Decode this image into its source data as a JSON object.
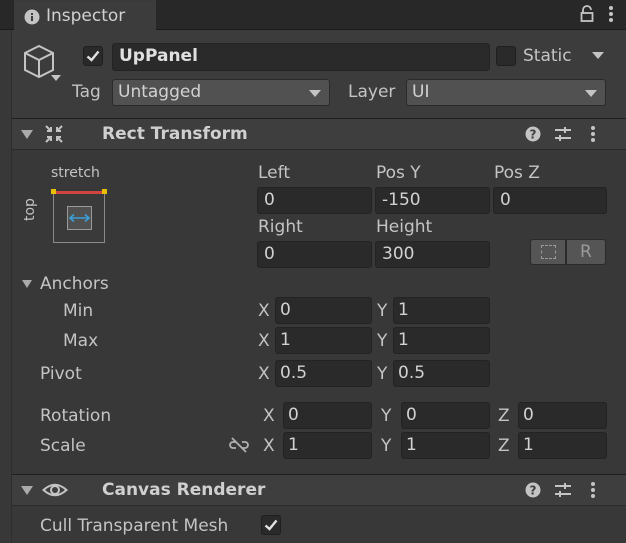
{
  "tab": {
    "title": "Inspector",
    "icon": "info-icon"
  },
  "object": {
    "active": true,
    "name": "UpPanel",
    "static_label": "Static",
    "static": false
  },
  "tag": {
    "label": "Tag",
    "value": "Untagged"
  },
  "layer": {
    "label": "Layer",
    "value": "UI"
  },
  "rect_transform": {
    "title": "Rect Transform",
    "anchor_preset": {
      "top_label": "stretch",
      "side_label": "top"
    },
    "labels": {
      "left": "Left",
      "pos_y": "Pos Y",
      "pos_z": "Pos Z",
      "right": "Right",
      "height": "Height"
    },
    "values": {
      "left": "0",
      "pos_y": "-150",
      "pos_z": "0",
      "right": "0",
      "height": "300"
    },
    "raw_button_label": "R",
    "anchors": {
      "label": "Anchors",
      "min": {
        "label": "Min",
        "x": "0",
        "y": "1"
      },
      "max": {
        "label": "Max",
        "x": "1",
        "y": "1"
      }
    },
    "pivot": {
      "label": "Pivot",
      "x": "0.5",
      "y": "0.5"
    },
    "rotation": {
      "label": "Rotation",
      "x": "0",
      "y": "0",
      "z": "0"
    },
    "scale": {
      "label": "Scale",
      "x": "1",
      "y": "1",
      "z": "1"
    },
    "axis": {
      "x": "X",
      "y": "Y",
      "z": "Z"
    }
  },
  "canvas_renderer": {
    "title": "Canvas Renderer",
    "cull_label": "Cull Transparent Mesh",
    "cull": true
  },
  "colors": {
    "bg": "#383838",
    "field": "#2a2a2a",
    "accent": "#3aa0d8",
    "anchor_red": "#d0453f",
    "anchor_yellow": "#e8c000"
  }
}
